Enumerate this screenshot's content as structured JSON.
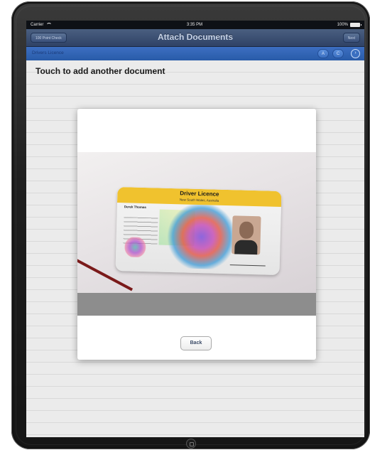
{
  "status_bar": {
    "carrier": "Carrier",
    "time": "3:35 PM",
    "battery": "100%"
  },
  "nav_bar": {
    "left_button": "100 Point Check",
    "title": "Attach Documents",
    "right_button": "Next"
  },
  "sub_bar": {
    "label": "Drivers Licence",
    "buttons": [
      "A",
      "C"
    ],
    "next_icon": "chevron-right-circle-icon"
  },
  "content": {
    "hint": "Touch to add another document"
  },
  "modal": {
    "card": {
      "title": "Driver Licence",
      "subtitle": "New South Wales, Australia",
      "name": "Derek Thomas"
    },
    "back_button": "Back"
  },
  "colors": {
    "nav_bar": "#34486c",
    "sub_bar": "#2f63b4",
    "card_band": "#f0c22e"
  }
}
